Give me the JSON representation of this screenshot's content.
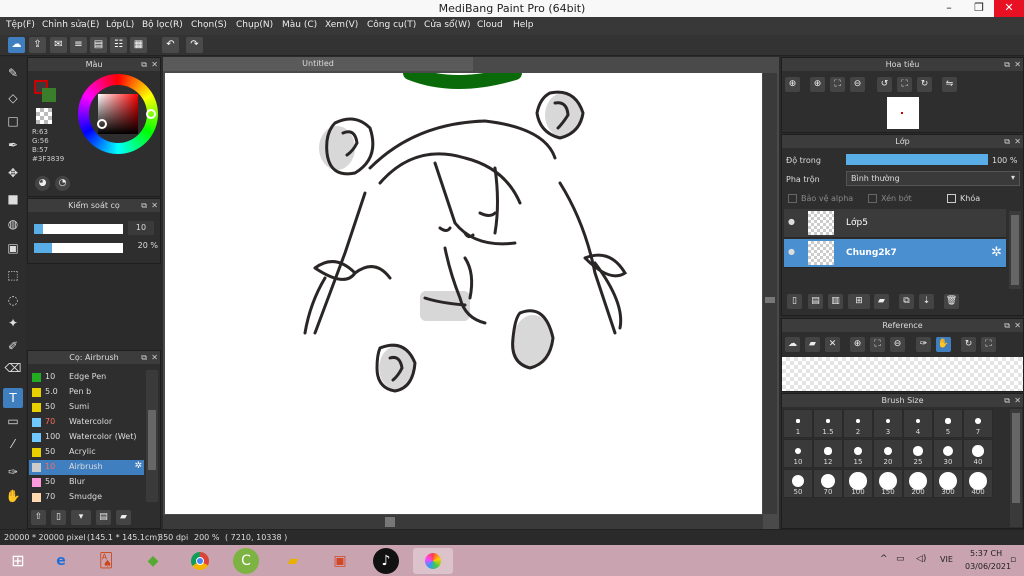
{
  "app": {
    "title": "MediBang Paint Pro (64bit)"
  },
  "menu": [
    "Tệp(F)",
    "Chỉnh sửa(E)",
    "Lớp(L)",
    "Bộ lọc(R)",
    "Chọn(S)",
    "Chụp(N)",
    "Màu (C)",
    "Xem(V)",
    "Công cụ(T)",
    "Cửa sổ(W)",
    "Cloud",
    "Help"
  ],
  "color_panel": {
    "title": "Màu",
    "r": "R:63",
    "g": "G:56",
    "b": "B:57",
    "hex": "#3F3839",
    "primary": "#3f3839"
  },
  "brush_control": {
    "title": "Kiểm soát cọ",
    "size": "10",
    "opacity": "20 %",
    "size_fraction": 0.1,
    "opacity_fraction": 0.2
  },
  "brush_panel": {
    "title": "Cọ: Airbrush",
    "brushes": [
      {
        "size": "10",
        "name": "Edge Pen",
        "color": "#22aa22",
        "red": false,
        "selected": false
      },
      {
        "size": "5.0",
        "name": "Pen b",
        "color": "#e8d000",
        "red": false,
        "selected": false
      },
      {
        "size": "50",
        "name": "Sumi",
        "color": "#e8d000",
        "red": false,
        "selected": false
      },
      {
        "size": "70",
        "name": "Watercolor",
        "color": "#6fc8ff",
        "red": true,
        "selected": false
      },
      {
        "size": "100",
        "name": "Watercolor (Wet)",
        "color": "#6fc8ff",
        "red": false,
        "selected": false
      },
      {
        "size": "50",
        "name": "Acrylic",
        "color": "#e8d000",
        "red": false,
        "selected": false
      },
      {
        "size": "10",
        "name": "Airbrush",
        "color": "#cccccc",
        "red": true,
        "selected": true
      },
      {
        "size": "50",
        "name": "Blur",
        "color": "#ff99dd",
        "red": false,
        "selected": false
      },
      {
        "size": "70",
        "name": "Smudge",
        "color": "#ffd9b0",
        "red": false,
        "selected": false
      }
    ]
  },
  "canvas": {
    "tab": "Untitled"
  },
  "navigator": {
    "title": "Hoa tiêu"
  },
  "layer_panel": {
    "title": "Lớp",
    "opacity_label": "Độ trong",
    "opacity_value": "100 %",
    "opacity_fraction": 1.0,
    "blend_label": "Pha trộn",
    "blend_value": "Bình thường",
    "protect_alpha": "Bảo vệ alpha",
    "clipping": "Xén bớt",
    "lock": "Khóa",
    "layers": [
      {
        "name": "Lớp5",
        "selected": false
      },
      {
        "name": "Chung2k7",
        "selected": true
      }
    ]
  },
  "reference": {
    "title": "Reference"
  },
  "brush_size": {
    "title": "Brush Size",
    "sizes": [
      "1",
      "1.5",
      "2",
      "3",
      "4",
      "5",
      "7",
      "10",
      "12",
      "15",
      "20",
      "25",
      "30",
      "40",
      "50",
      "70",
      "100",
      "150",
      "200",
      "300",
      "400"
    ]
  },
  "status": {
    "dimensions": "20000 * 20000 pixel",
    "physical": "(145.1 * 145.1cm)",
    "dpi": "350 dpi",
    "zoom": "200 %",
    "coords": "( 7210, 10338 )"
  },
  "taskbar": {
    "lang": "VIE",
    "time": "5:37 CH",
    "date": "03/06/2021"
  }
}
